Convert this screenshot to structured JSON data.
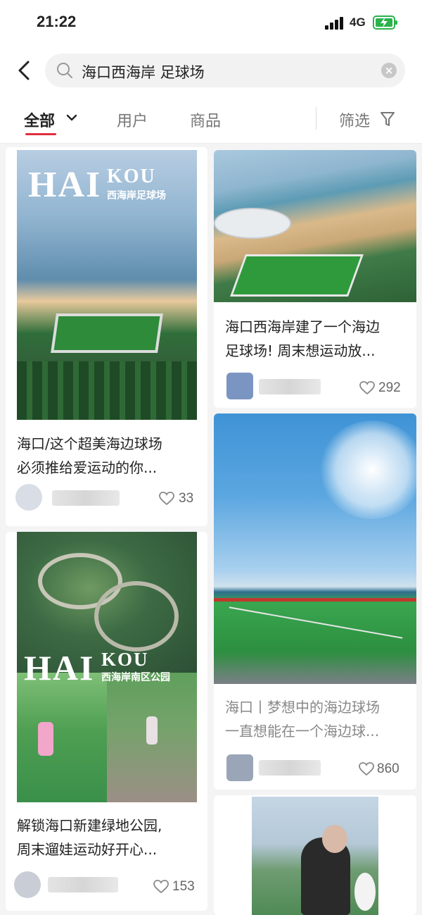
{
  "status": {
    "time": "21:22",
    "network": "4G"
  },
  "search": {
    "query": "海口西海岸 足球场"
  },
  "tabs": {
    "all": "全部",
    "users": "用户",
    "goods": "商品",
    "filter": "筛选"
  },
  "cards": [
    {
      "title_line1": "海口/这个超美海边球场",
      "title_line2": "必须推给爱运动的你...",
      "likes": "33",
      "overlay_big": "HAI",
      "overlay_small": "KOU",
      "overlay_sub": "西海岸足球场"
    },
    {
      "title_line1": "海口西海岸建了一个海边",
      "title_line2": "足球场! 周末想运动放...",
      "likes": "292"
    },
    {
      "title_line1": "海口丨梦想中的海边球场",
      "title_line2": "一直想能在一个海边球...",
      "likes": "860"
    },
    {
      "title_line1": "解锁海口新建绿地公园,",
      "title_line2": "周末遛娃运动好开心...",
      "likes": "153",
      "overlay_big": "HAI",
      "overlay_small": "KOU",
      "overlay_sub": "西海岸南区公园"
    }
  ]
}
